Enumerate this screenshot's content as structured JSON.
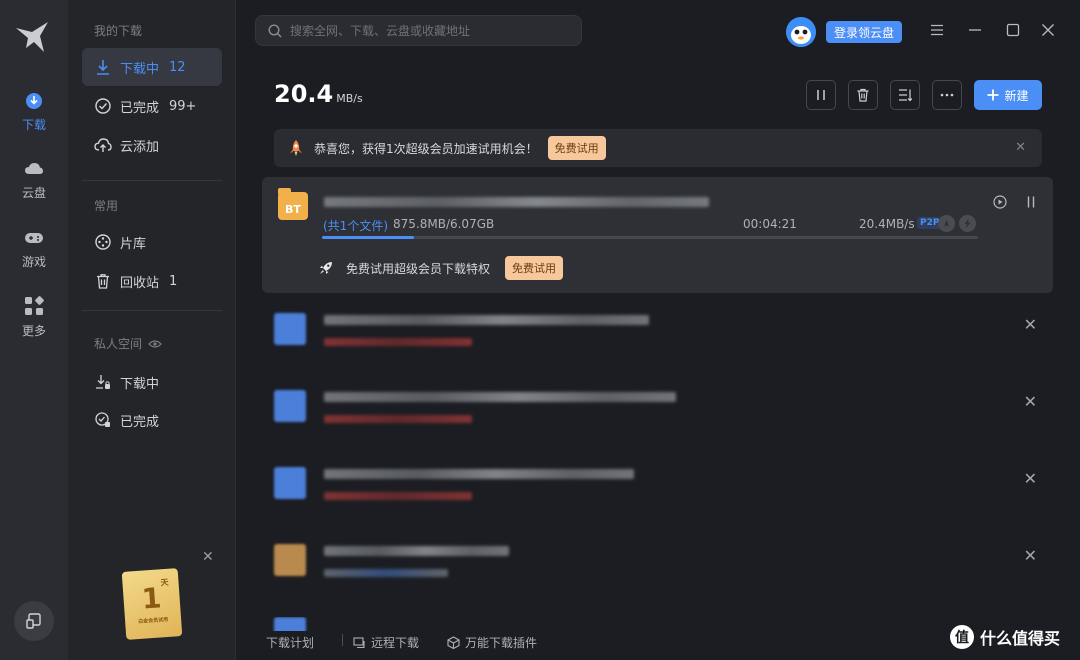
{
  "rail": {
    "items": [
      {
        "label": "下载",
        "icon": "download-icon"
      },
      {
        "label": "云盘",
        "icon": "cloud-icon"
      },
      {
        "label": "游戏",
        "icon": "gamepad-icon"
      },
      {
        "label": "更多",
        "icon": "apps-icon"
      }
    ]
  },
  "sidebar": {
    "my_downloads_title": "我的下载",
    "downloading": {
      "label": "下载中",
      "count": "12"
    },
    "completed": {
      "label": "已完成",
      "count": "99+"
    },
    "cloud_add": {
      "label": "云添加"
    },
    "common_title": "常用",
    "library": {
      "label": "片库"
    },
    "recycle": {
      "label": "回收站",
      "count": "1"
    },
    "private_title": "私人空间",
    "private_downloading": {
      "label": "下载中"
    },
    "private_completed": {
      "label": "已完成"
    },
    "promo": {
      "number": "1",
      "unit": "天",
      "subtitle": "白金会员试用"
    }
  },
  "topbar": {
    "search_placeholder": "搜索全网、下载、云盘或收藏地址",
    "login_label": "登录领云盘"
  },
  "toolbar": {
    "speed_value": "20.4",
    "speed_unit": "MB/s",
    "new_label": "新建"
  },
  "banner": {
    "text": "恭喜您，获得1次超级会员加速试用机会！",
    "button": "免费试用"
  },
  "active_task": {
    "icon_label": "BT",
    "files": "(共1个文件)",
    "size": "875.8MB/6.07GB",
    "time_left": "00:04:21",
    "speed": "20.4MB/s",
    "p2p_tag": "P2P",
    "progress": 0.14,
    "promo_text": "免费试用超级会员下载特权",
    "promo_button": "免费试用"
  },
  "footer": {
    "plan": "下载计划",
    "remote": "远程下载",
    "plugin": "万能下载插件"
  },
  "watermark": {
    "mark": "值",
    "text": "什么值得买"
  },
  "colors": {
    "accent": "#4b8ef6",
    "promo": "#f6c89b",
    "bt": "#f2b04a"
  }
}
